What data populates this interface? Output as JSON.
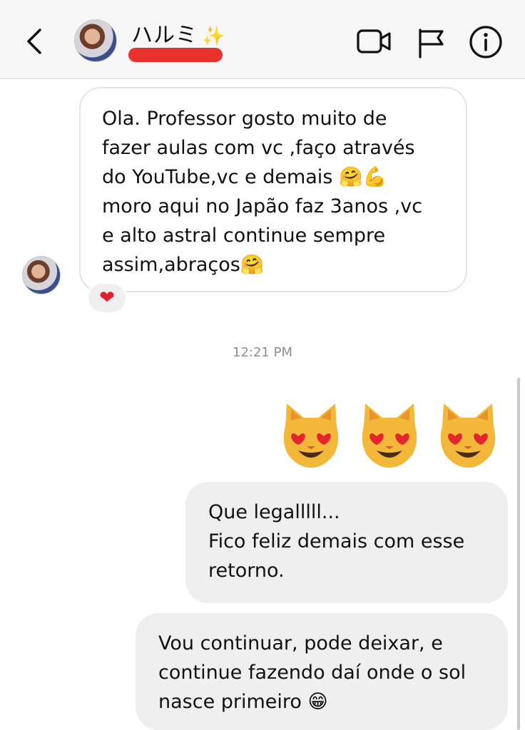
{
  "header": {
    "contact_name": "ハルミ",
    "sparkle": "✨",
    "icons": [
      "back-chevron-icon",
      "video-camera-icon",
      "flag-icon",
      "info-icon"
    ]
  },
  "incoming": {
    "text": "Ola. Professor gosto muito de\nfazer aulas com vc ,faço através\ndo YouTube,vc e demais 🤗💪\nmoro aqui no Japão faz 3anos ,vc\ne alto astral continue sempre\nassim,abraços🤗",
    "reaction": "❤"
  },
  "timestamp": "12:21 PM",
  "outgoing": {
    "emoji_row": [
      "😻",
      "😻",
      "😻"
    ],
    "message1": "Que legalllll...\nFico feliz demais com esse\nretorno.",
    "message2": "Vou continuar, pode deixar, e\ncontinue fazendo daí onde o sol\nnasce primeiro 😁"
  },
  "colors": {
    "header_bg": "#f7f7f7",
    "bubble_out": "#efefef",
    "bubble_in_border": "#e4e4e4",
    "redaction": "#e8322e"
  }
}
